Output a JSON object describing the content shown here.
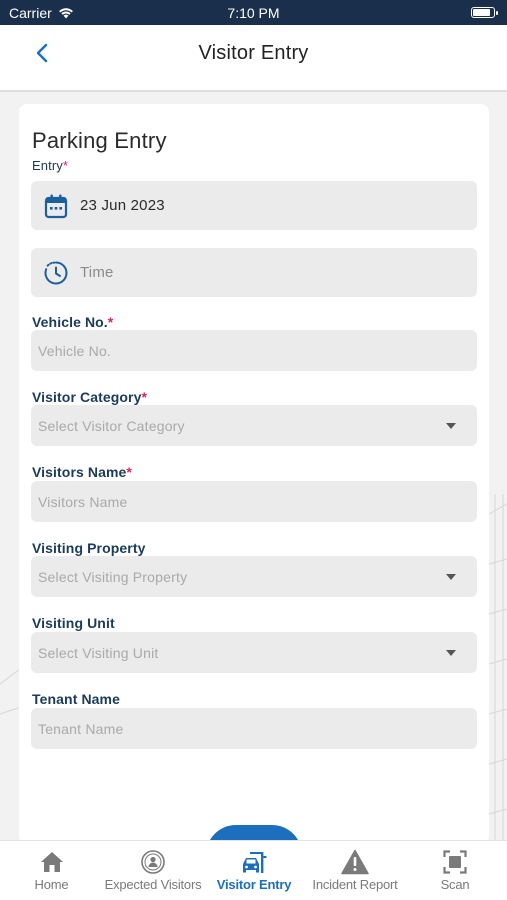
{
  "status_bar": {
    "carrier": "Carrier",
    "time": "7:10 PM",
    "battery_level": 0.95
  },
  "nav": {
    "title": "Visitor Entry",
    "back_icon": "chevron-left-icon"
  },
  "form": {
    "title": "Parking Entry",
    "entry": {
      "label": "Entry",
      "required": "*",
      "date_value": "23 Jun 2023",
      "time_placeholder": "Time"
    },
    "vehicle_no": {
      "label": "Vehicle No.",
      "required": "*",
      "placeholder": "Vehicle No."
    },
    "visitor_category": {
      "label": "Visitor Category",
      "required": "*",
      "placeholder": "Select Visitor Category"
    },
    "visitors_name": {
      "label": "Visitors Name",
      "required": "*",
      "placeholder": "Visitors Name"
    },
    "visiting_property": {
      "label": "Visiting Property",
      "placeholder": "Select Visiting Property"
    },
    "visiting_unit": {
      "label": "Visiting Unit",
      "placeholder": "Select Visiting Unit"
    },
    "tenant_name": {
      "label": "Tenant Name",
      "placeholder": "Tenant Name"
    }
  },
  "tabs": [
    {
      "label": "Home",
      "icon": "home-icon",
      "active": false
    },
    {
      "label": "Expected Visitors",
      "icon": "visitors-icon",
      "active": false
    },
    {
      "label": "Visitor Entry",
      "icon": "car-entry-icon",
      "active": true
    },
    {
      "label": "Incident Report",
      "icon": "warning-icon",
      "active": false
    },
    {
      "label": "Scan",
      "icon": "scan-icon",
      "active": false
    }
  ],
  "colors": {
    "accent": "#1c6fbc",
    "header": "#1a2f4c",
    "required": "#e0245e",
    "label": "#1b3b5a"
  }
}
